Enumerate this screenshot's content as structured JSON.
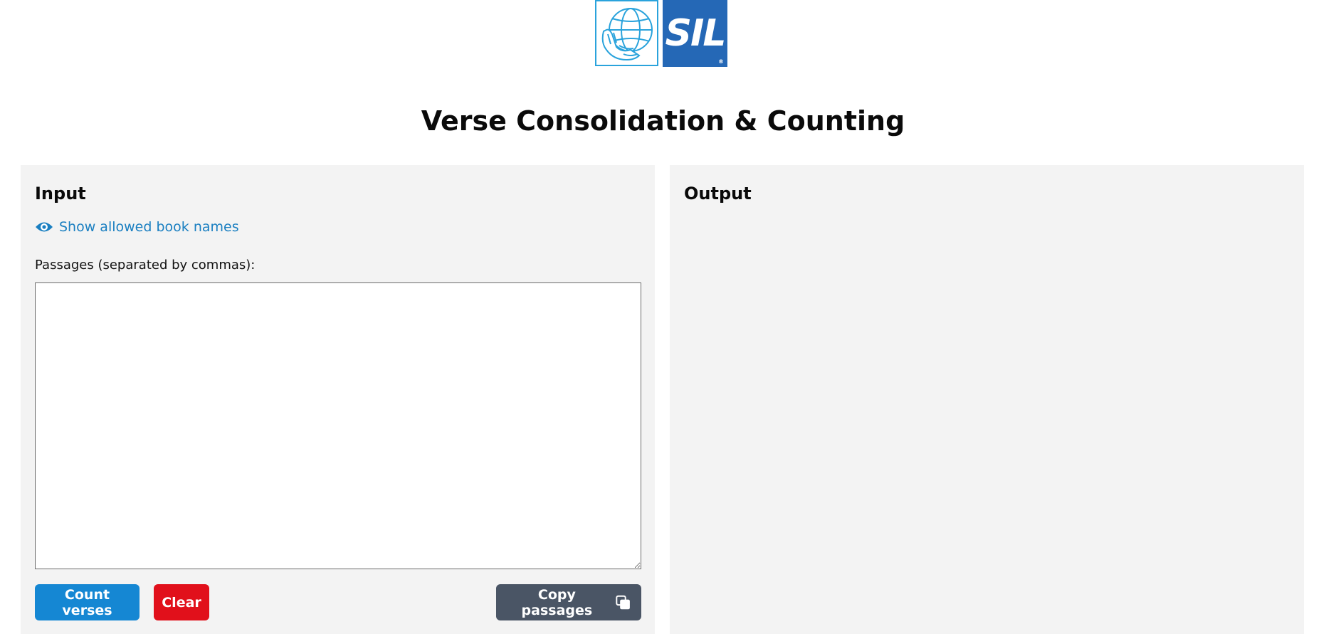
{
  "header": {
    "logo_text": "SIL",
    "title": "Verse Consolidation & Counting"
  },
  "input_panel": {
    "heading": "Input",
    "show_books_link": "Show allowed book names",
    "passages_label": "Passages (separated by commas):",
    "passages_value": "",
    "count_button": "Count verses",
    "clear_button": "Clear",
    "copy_button": "Copy passages"
  },
  "output_panel": {
    "heading": "Output"
  },
  "icons": {
    "show_books": "eye-icon",
    "copy": "copy-icon"
  },
  "colors": {
    "accent_blue": "#1587d3",
    "link_blue": "#1a7fc1",
    "danger_red": "#e1101b",
    "neutral_dark": "#4a5565",
    "sil_blue": "#2568b6",
    "globe_blue": "#2aa3dc",
    "panel_bg": "#f3f3f3"
  }
}
